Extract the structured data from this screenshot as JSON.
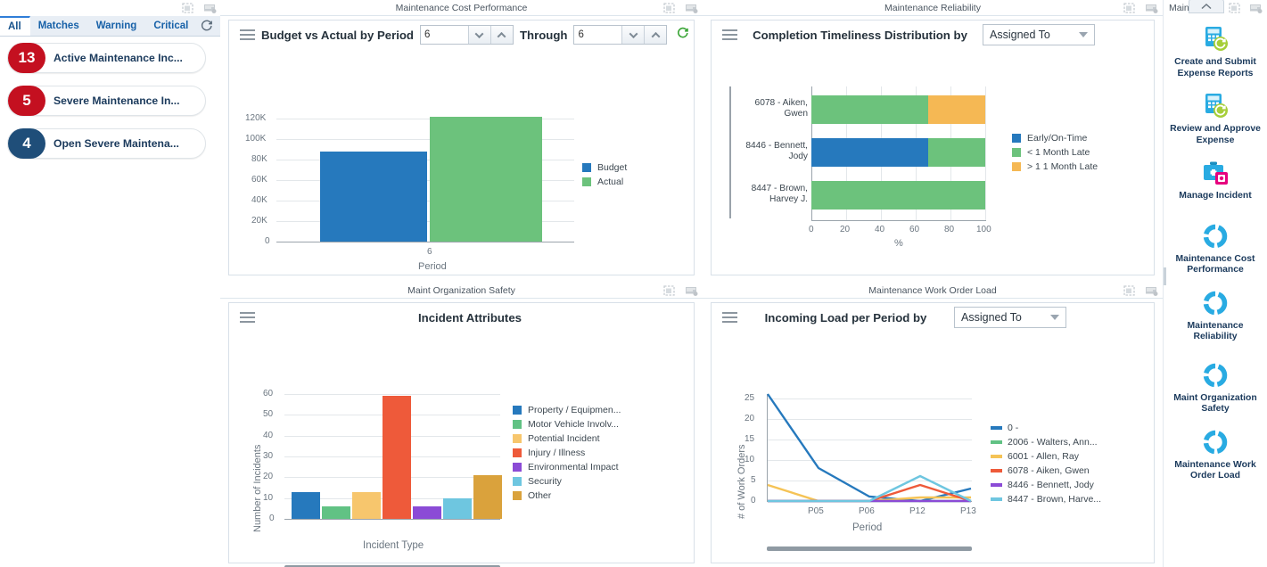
{
  "left_sidebar": {
    "tabs": [
      {
        "label": "All",
        "active": true
      },
      {
        "label": "Matches",
        "active": false
      },
      {
        "label": "Warning",
        "active": false
      },
      {
        "label": "Critical",
        "active": false
      }
    ],
    "refresh_icon": "refresh-icon",
    "header_icons": [
      "expand-icon",
      "notes-icon"
    ],
    "cards": [
      {
        "count": "13",
        "label": "Active Maintenance Inc...",
        "color": "#c41020"
      },
      {
        "count": "5",
        "label": "Severe Maintenance In...",
        "color": "#c41020"
      },
      {
        "count": "4",
        "label": "Open Severe Maintena...",
        "color": "#1f4e79"
      }
    ]
  },
  "panels": [
    {
      "id": "maintenance-cost-performance",
      "title": "Maintenance Cost Performance",
      "icons": [
        "expand-icon",
        "notes-icon"
      ],
      "toolbar": {
        "menu_icon": "hamburger-icon",
        "chart_title": "Budget vs Actual by Period",
        "period_from": "6",
        "through_label": "Through",
        "period_to": "6",
        "refresh_icon": "refresh-icon"
      }
    },
    {
      "id": "maintenance-reliability",
      "title": "Maintenance Reliability",
      "icons": [
        "expand-icon",
        "notes-icon"
      ],
      "toolbar": {
        "menu_icon": "hamburger-icon",
        "chart_title": "Completion Timeliness Distribution by",
        "group_by_value": "Assigned To",
        "dropdown_icon": "chevron-down-icon"
      }
    },
    {
      "id": "maint-organization-safety",
      "title": "Maint Organization Safety",
      "icons": [
        "expand-icon",
        "notes-icon"
      ],
      "toolbar": {
        "menu_icon": "hamburger-icon",
        "chart_title": "Incident Attributes"
      }
    },
    {
      "id": "maintenance-work-order-load",
      "title": "Maintenance Work Order Load",
      "icons": [
        "expand-icon",
        "notes-icon"
      ],
      "toolbar": {
        "menu_icon": "hamburger-icon",
        "chart_title": "Incoming Load per Period by",
        "group_by_value": "Assigned To",
        "dropdown_icon": "chevron-down-icon"
      }
    }
  ],
  "chart_data": [
    {
      "type": "bar",
      "id": "budget-vs-actual",
      "title": "Budget vs Actual by Period",
      "categories": [
        "6"
      ],
      "series": [
        {
          "name": "Budget",
          "values": [
            87000
          ],
          "color": "#2679bd"
        },
        {
          "name": "Actual",
          "values": [
            120000
          ],
          "color": "#6cc27c"
        }
      ],
      "xlabel": "Period",
      "ylabel": "",
      "ylim": [
        0,
        120000
      ],
      "yticks": [
        "0",
        "20K",
        "40K",
        "60K",
        "80K",
        "100K",
        "120K"
      ],
      "grid": true,
      "legend_position": "right"
    },
    {
      "type": "bar",
      "id": "completion-timeliness-distribution",
      "orientation": "horizontal",
      "stacked": true,
      "title": "Completion Timeliness Distribution by",
      "categories": [
        "6078 - Aiken, Gwen",
        "8446 - Bennett, Jody",
        "8447 - Brown, Harvey J."
      ],
      "series": [
        {
          "name": "Early/On-Time",
          "values": [
            0,
            67,
            0
          ],
          "color": "#2679bd"
        },
        {
          "name": "< 1 Month Late",
          "values": [
            67,
            33,
            100
          ],
          "color": "#6cc27c"
        },
        {
          "name": "> 1 1 Month Late",
          "values": [
            33,
            0,
            0
          ],
          "color": "#f5b854"
        }
      ],
      "xlabel": "%",
      "xlim": [
        0,
        100
      ],
      "xticks": [
        "0",
        "20",
        "40",
        "60",
        "80",
        "100"
      ],
      "grid": true,
      "legend_position": "right"
    },
    {
      "type": "bar",
      "id": "incident-attributes",
      "title": "Incident Attributes",
      "categories": [
        "Property / Equipmen...",
        "Motor Vehicle Involv...",
        "Potential Incident",
        "Injury / Illness",
        "Environmental Impact",
        "Security",
        "Other"
      ],
      "values": [
        13,
        6,
        13,
        59,
        6,
        10,
        21
      ],
      "colors": [
        "#2679bd",
        "#61c284",
        "#f7c66d",
        "#ee5a3a",
        "#8b4bd6",
        "#6ec6e0",
        "#daa23c"
      ],
      "xlabel": "Incident Type",
      "ylabel": "Number of Incidents",
      "ylim": [
        0,
        60
      ],
      "yticks": [
        "0",
        "10",
        "20",
        "30",
        "40",
        "50",
        "60"
      ],
      "grid": true,
      "legend_position": "right"
    },
    {
      "type": "line",
      "id": "incoming-load-per-period",
      "title": "Incoming Load per Period by",
      "x": [
        "",
        "P05",
        "P06",
        "P12",
        "P13"
      ],
      "series": [
        {
          "name": "0 -",
          "values": [
            26,
            8,
            1,
            0,
            3
          ],
          "color": "#2679bd"
        },
        {
          "name": "2006 - Walters, Ann...",
          "values": [
            0,
            0,
            0,
            0,
            0
          ],
          "color": "#61c284"
        },
        {
          "name": "6001 - Allen, Ray",
          "values": [
            4,
            0,
            0,
            1,
            1
          ],
          "color": "#f5c356"
        },
        {
          "name": "6078 - Aiken, Gwen",
          "values": [
            0,
            0,
            0,
            4,
            0
          ],
          "color": "#ee5a3a"
        },
        {
          "name": "8446 - Bennett, Jody",
          "values": [
            0,
            0,
            0,
            0,
            0
          ],
          "color": "#8b4bd6"
        },
        {
          "name": "8447 - Brown, Harve...",
          "values": [
            0,
            0,
            0,
            6,
            0
          ],
          "color": "#6ec6e0"
        }
      ],
      "xlabel": "Period",
      "ylabel": "# of Work Orders",
      "ylim": [
        0,
        26
      ],
      "yticks": [
        "0",
        "5",
        "10",
        "15",
        "20",
        "25"
      ],
      "grid": true,
      "legend_position": "right"
    }
  ],
  "right_sidebar": {
    "top_label": "Main...",
    "collapse_icon": "chevron-up-icon",
    "header_icons": [
      "expand-icon",
      "notes-icon"
    ],
    "items": [
      {
        "label": "Create and Submit Expense Reports",
        "icon": "calculator-refresh-icon"
      },
      {
        "label": "Review and Approve Expense",
        "icon": "calculator-refresh-icon"
      },
      {
        "label": "Manage Incident",
        "icon": "briefcase-incident-icon"
      },
      {
        "label": "Maintenance Cost Performance",
        "icon": "donut-chart-icon"
      },
      {
        "label": "Maintenance Reliability",
        "icon": "donut-chart-icon"
      },
      {
        "label": "Maint Organization Safety",
        "icon": "donut-chart-icon"
      },
      {
        "label": "Maintenance Work Order Load",
        "icon": "donut-chart-icon"
      }
    ]
  }
}
